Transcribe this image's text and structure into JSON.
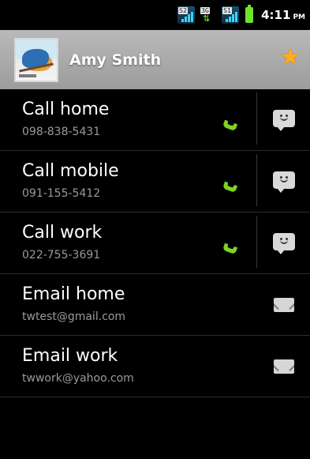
{
  "status_bar": {
    "signal_1_tag": "S2",
    "data_tag": "3G",
    "signal_2_tag": "S1",
    "time": "4:11",
    "ampm": "PM"
  },
  "contact": {
    "name": "Amy Smith"
  },
  "rows": [
    {
      "title": "Call home",
      "subtitle": "098-838-5431"
    },
    {
      "title": "Call mobile",
      "subtitle": "091-155-5412"
    },
    {
      "title": "Call work",
      "subtitle": "022-755-3691"
    },
    {
      "title": "Email home",
      "subtitle": "twtest@gmail.com"
    },
    {
      "title": "Email work",
      "subtitle": "twwork@yahoo.com"
    }
  ],
  "colors": {
    "phone_icon": "#7ed321",
    "star": "#ffae1a"
  }
}
